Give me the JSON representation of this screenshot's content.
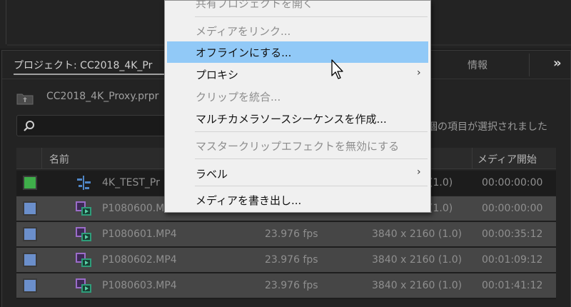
{
  "project_panel": {
    "tab_title": "プロジェクト: CC2018_4K_Pr",
    "info_tab": "情報",
    "more_glyph": "»",
    "bin_path": "CC2018_4K_Proxy.prpr",
    "selection_status": "個の項目が選択されました",
    "columns": {
      "name": "名前",
      "media_start": "メディア開始"
    },
    "rows": [
      {
        "name": "4K_TEST_Pr",
        "fps": "",
        "resolution": "(1.0)",
        "start": "00:00:00:00",
        "color": "#3fae4a",
        "icon": "sequence-icon"
      },
      {
        "name": "P1080600.MP",
        "fps": "",
        "resolution": "(1.0)",
        "start": "00:00:00:00",
        "color": "#6b8fcb",
        "icon": "video-clip-icon"
      },
      {
        "name": "P1080601.MP4",
        "fps": "23.976 fps",
        "resolution": "3840 x 2160 (1.0)",
        "start": "00:00:35:12",
        "color": "#6b8fcb",
        "icon": "video-clip-icon"
      },
      {
        "name": "P1080602.MP4",
        "fps": "23.976 fps",
        "resolution": "3840 x 2160 (1.0)",
        "start": "00:01:09:12",
        "color": "#6b8fcb",
        "icon": "video-clip-icon"
      },
      {
        "name": "P1080603.MP4",
        "fps": "23.976 fps",
        "resolution": "3840 x 2160 (1.0)",
        "start": "00:01:41:12",
        "color": "#6b8fcb",
        "icon": "video-clip-icon"
      }
    ]
  },
  "context_menu": {
    "items": [
      {
        "label": "共有プロジェクトを開く",
        "enabled": false
      },
      {
        "label": "メディアをリンク...",
        "enabled": false
      },
      {
        "label": "オフラインにする...",
        "enabled": true,
        "hover": true
      },
      {
        "label": "プロキシ",
        "enabled": true,
        "submenu": true
      },
      {
        "label": "クリップを統合...",
        "enabled": false
      },
      {
        "label": "マルチカメラソースシーケンスを作成...",
        "enabled": true
      },
      {
        "label": "マスタークリップエフェクトを無効にする",
        "enabled": false
      },
      {
        "label": "ラベル",
        "enabled": true,
        "submenu": true
      },
      {
        "label": "メディアを書き出し...",
        "enabled": true
      }
    ],
    "submenu_arrow": "›"
  },
  "colors": {
    "highlight": "#91c9f7",
    "panel_bg": "#232323",
    "menu_bg": "#f0f0f0"
  }
}
